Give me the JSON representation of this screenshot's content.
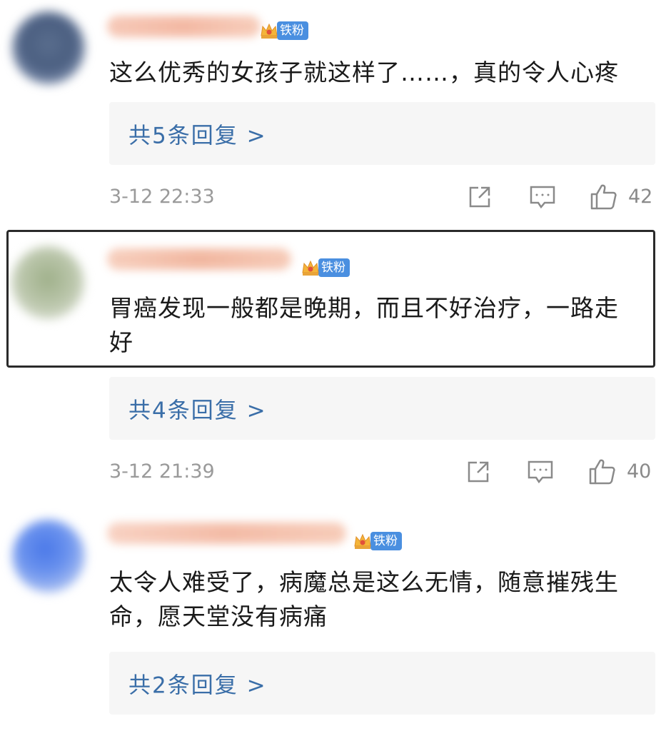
{
  "fan_badge_label": "铁粉",
  "comments": [
    {
      "text": "这么优秀的女孩子就这样了……，真的令人心疼",
      "replies_label": "共5条回复 >",
      "timestamp": "3-12 22:33",
      "likes": "42"
    },
    {
      "text": "胃癌发现一般都是晚期，而且不好治疗，一路走好",
      "replies_label": "共4条回复 >",
      "timestamp": "3-12 21:39",
      "likes": "40"
    },
    {
      "text": "太令人难受了，病魔总是这么无情，随意摧残生命，愿天堂没有病痛",
      "replies_label": "共2条回复 >"
    }
  ],
  "colors": {
    "fan_badge": "#4a8fe0",
    "reply_link": "#3a6ea8",
    "timestamp": "#9a9a9a",
    "highlight_border": "#2a2a2a"
  },
  "icons": [
    "share-icon",
    "comment-icon",
    "like-icon",
    "crown-icon"
  ]
}
